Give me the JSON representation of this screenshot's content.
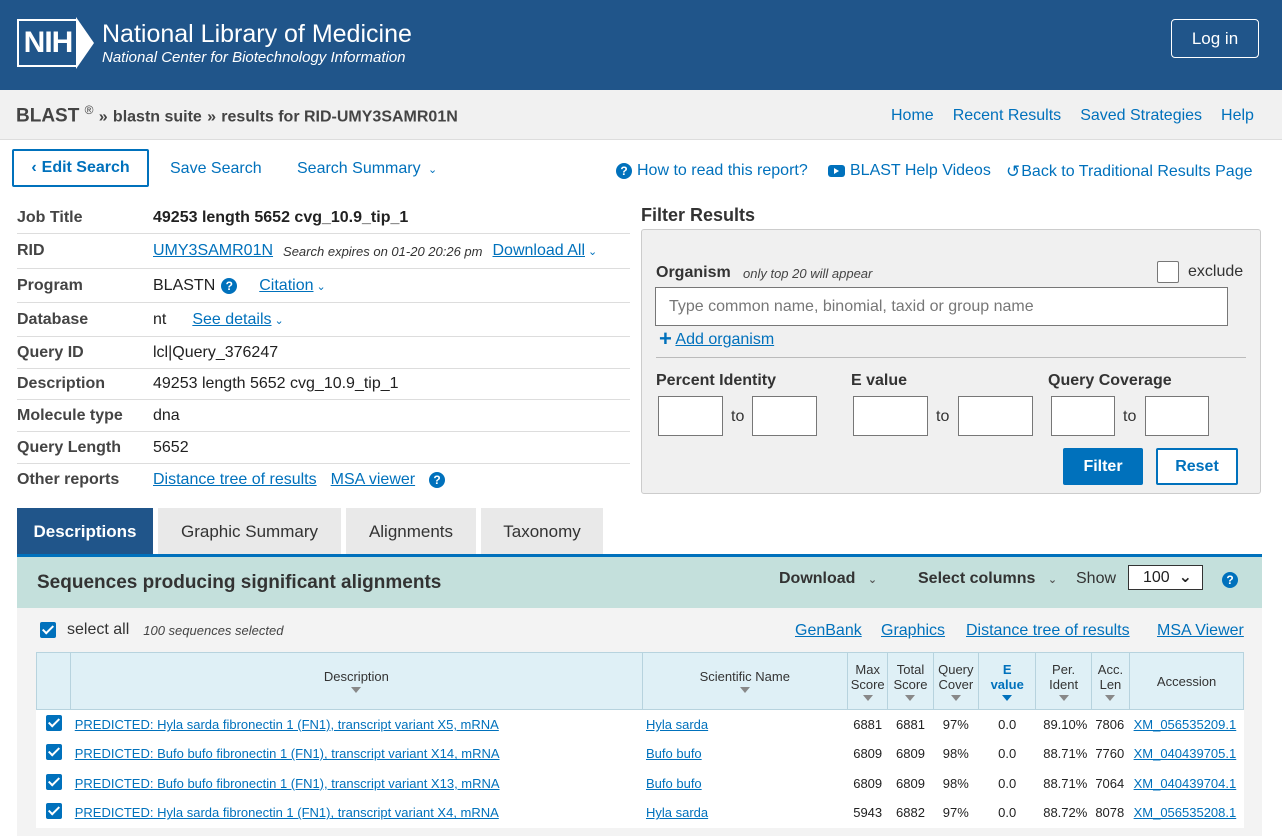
{
  "header": {
    "logo_text": "NIH",
    "title": "National Library of Medicine",
    "subtitle": "National Center for Biotechnology Information",
    "login_label": "Log in"
  },
  "breadcrumb": {
    "blast": "BLAST",
    "registered": "®",
    "sep1": "»",
    "suite": "blastn suite",
    "sep2": "»",
    "results": "results for RID-UMY3SAMR01N"
  },
  "topnav": [
    "Home",
    "Recent Results",
    "Saved Strategies",
    "Help"
  ],
  "actions": {
    "edit": "Edit Search",
    "save": "Save Search",
    "summary": "Search Summary",
    "how_to_read": "How to read this report?",
    "help_videos": "BLAST Help Videos",
    "back": "Back to Traditional Results Page"
  },
  "job": {
    "title_label": "Job Title",
    "title_value": "49253 length 5652 cvg_10.9_tip_1",
    "rid_label": "RID",
    "rid_value": "UMY3SAMR01N",
    "rid_expires": "Search expires on 01-20 20:26 pm",
    "download_all": "Download All",
    "program_label": "Program",
    "program_value": "BLASTN",
    "citation": "Citation",
    "database_label": "Database",
    "database_value": "nt",
    "see_details": "See details",
    "query_id_label": "Query ID",
    "query_id_value": "lcl|Query_376247",
    "description_label": "Description",
    "description_value": "49253 length 5652 cvg_10.9_tip_1",
    "molecule_label": "Molecule type",
    "molecule_value": "dna",
    "length_label": "Query Length",
    "length_value": "5652",
    "other_label": "Other reports",
    "distance_tree": "Distance tree of results",
    "msa_viewer": "MSA viewer"
  },
  "filter": {
    "title": "Filter Results",
    "organism_label": "Organism",
    "organism_note": "only top 20 will appear",
    "exclude_label": "exclude",
    "organism_placeholder": "Type common  name, binomial, taxid or group  name",
    "add_organism": "Add organism",
    "percent_identity": "Percent Identity",
    "e_value": "E value",
    "query_coverage": "Query Coverage",
    "to": "to",
    "filter_btn": "Filter",
    "reset_btn": "Reset"
  },
  "tabs": [
    "Descriptions",
    "Graphic Summary",
    "Alignments",
    "Taxonomy"
  ],
  "results": {
    "title": "Sequences producing significant alignments",
    "download": "Download",
    "select_columns": "Select columns",
    "show_label": "Show",
    "show_value": "100",
    "select_all": "select all",
    "selected_count": "100 sequences selected",
    "links": [
      "GenBank",
      "Graphics",
      "Distance tree of results",
      "MSA Viewer"
    ]
  },
  "table": {
    "headers": {
      "description": "Description",
      "scientific_name": "Scientific Name",
      "max_score_1": "Max",
      "max_score_2": "Score",
      "total_score_1": "Total",
      "total_score_2": "Score",
      "query_cover_1": "Query",
      "query_cover_2": "Cover",
      "e_value_1": "E",
      "e_value_2": "value",
      "per_ident_1": "Per.",
      "per_ident_2": "Ident",
      "acc_len_1": "Acc.",
      "acc_len_2": "Len",
      "accession": "Accession"
    },
    "rows": [
      {
        "description": "PREDICTED: Hyla sarda fibronectin 1 (FN1), transcript variant X5, mRNA",
        "scientific_name": "Hyla sarda",
        "max_score": "6881",
        "total_score": "6881",
        "query_cover": "97%",
        "e_value": "0.0",
        "per_ident": "89.10%",
        "acc_len": "7806",
        "accession": "XM_056535209.1"
      },
      {
        "description": "PREDICTED: Bufo bufo fibronectin 1 (FN1), transcript variant X14, mRNA",
        "scientific_name": "Bufo bufo",
        "max_score": "6809",
        "total_score": "6809",
        "query_cover": "98%",
        "e_value": "0.0",
        "per_ident": "88.71%",
        "acc_len": "7760",
        "accession": "XM_040439705.1"
      },
      {
        "description": "PREDICTED: Bufo bufo fibronectin 1 (FN1), transcript variant X13, mRNA",
        "scientific_name": "Bufo bufo",
        "max_score": "6809",
        "total_score": "6809",
        "query_cover": "98%",
        "e_value": "0.0",
        "per_ident": "88.71%",
        "acc_len": "7064",
        "accession": "XM_040439704.1"
      },
      {
        "description": "PREDICTED: Hyla sarda fibronectin 1 (FN1), transcript variant X4, mRNA",
        "scientific_name": "Hyla sarda",
        "max_score": "5943",
        "total_score": "6882",
        "query_cover": "97%",
        "e_value": "0.0",
        "per_ident": "88.72%",
        "acc_len": "8078",
        "accession": "XM_056535208.1"
      }
    ]
  }
}
